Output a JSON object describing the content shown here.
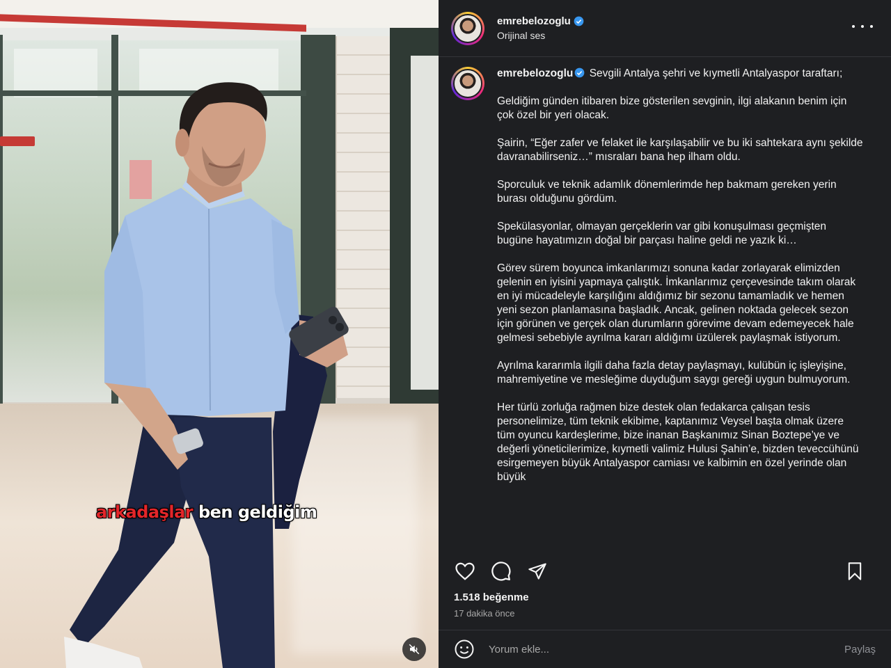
{
  "media": {
    "subtitle_highlight": "arkadaşlar",
    "subtitle_rest": " ben geldiğim",
    "mute_icon": "speaker-muted-icon"
  },
  "header": {
    "username": "emrebelozoglu",
    "audio_label": "Orijinal ses",
    "more_icon": "more-horizontal-icon"
  },
  "caption": {
    "username": "emrebelozoglu",
    "paragraphs": [
      "Sevgili Antalya şehri ve kıymetli Antalyaspor taraftarı;",
      "Geldiğim günden itibaren bize gösterilen sevginin, ilgi alakanın benim için çok özel bir yeri olacak.",
      "Şairin, “Eğer zafer ve felaket ile karşılaşabilir ve bu iki sahtekara aynı şekilde davranabilirseniz…” mısraları bana hep ilham oldu.",
      "Sporculuk ve teknik adamlık dönemlerimde hep bakmam gereken yerin burası olduğunu gördüm.",
      "Spekülasyonlar, olmayan gerçeklerin var gibi konuşulması geçmişten bugüne hayatımızın doğal bir parçası haline geldi ne yazık ki…",
      "Görev sürem boyunca imkanlarımızı sonuna kadar zorlayarak elimizden gelenin en iyisini yapmaya çalıştık. İmkanlarımız çerçevesinde takım olarak en iyi mücadeleyle karşılığını aldığımız bir sezonu tamamladık ve hemen yeni sezon planlamasına başladık. Ancak, gelinen noktada gelecek sezon için görünen ve gerçek olan durumların görevime devam edemeyecek hale gelmesi sebebiyle ayrılma kararı aldığımı üzülerek paylaşmak istiyorum.",
      "Ayrılma kararımla ilgili daha fazla detay paylaşmayı, kulübün iç işleyişine, mahremiyetine ve mesleğime duyduğum saygı gereği uygun bulmuyorum.",
      "Her türlü zorluğa rağmen bize destek olan fedakarca çalışan tesis personelimize, tüm teknik ekibime, kaptanımız Veysel başta olmak üzere tüm oyuncu kardeşlerime, bize inanan Başkanımız Sinan Boztepe’ye ve değerli yöneticilerimize, kıymetli valimiz Hulusi Şahin’e, bizden teveccühünü esirgemeyen büyük Antalyaspor camiası ve kalbimin en özel yerinde olan büyük"
    ]
  },
  "actions": {
    "like_icon": "heart-icon",
    "comment_icon": "comment-icon",
    "share_icon": "send-icon",
    "save_icon": "bookmark-icon"
  },
  "stats": {
    "likes": "1.518 beğenme",
    "time": "17 dakika önce"
  },
  "comment": {
    "emoji_icon": "emoji-icon",
    "placeholder": "Yorum ekle...",
    "submit_label": "Paylaş"
  },
  "colors": {
    "panel_bg": "#1e1f22",
    "verified_blue": "#3897f0",
    "subtitle_red": "#e3262a"
  }
}
